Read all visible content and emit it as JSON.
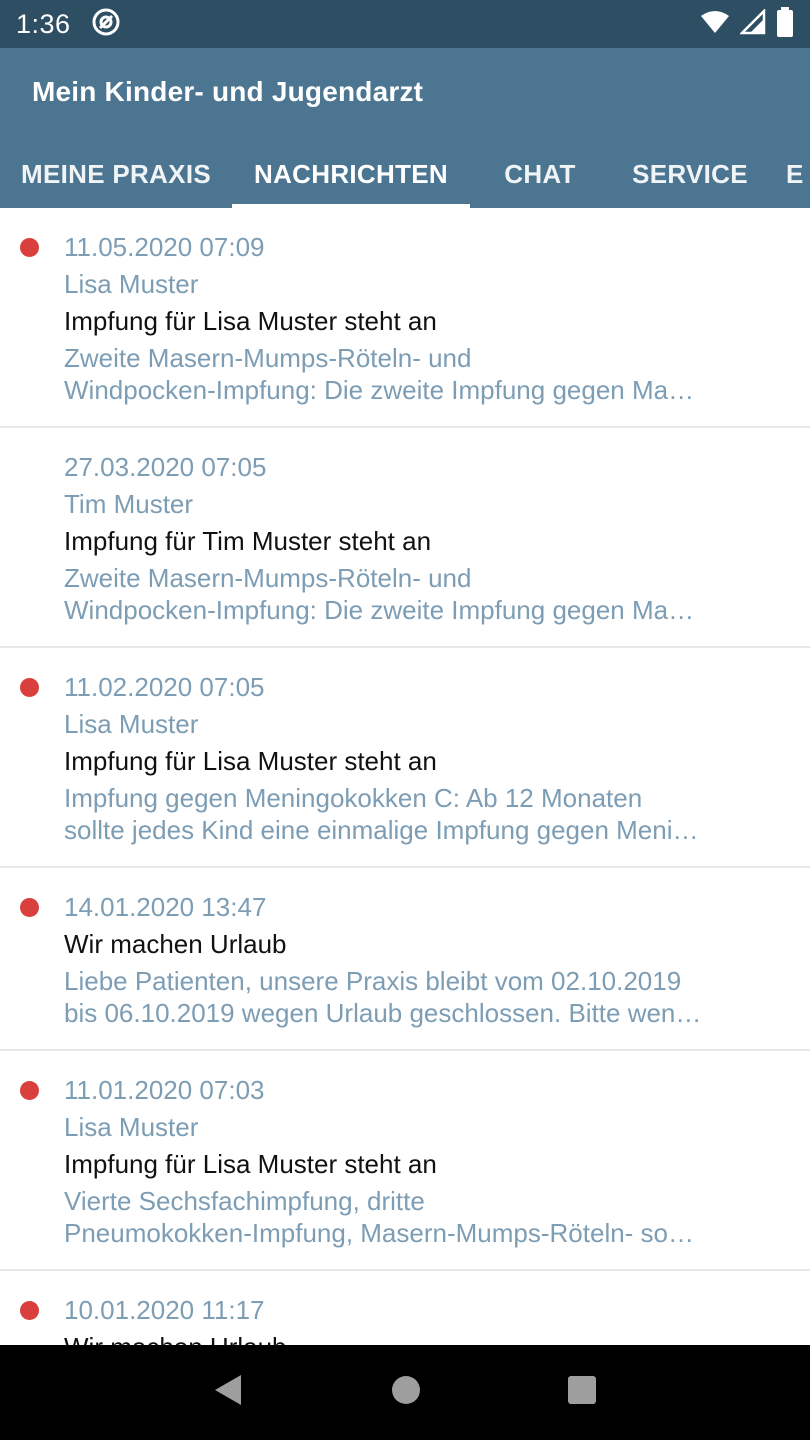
{
  "status_bar": {
    "time": "1:36",
    "icons": [
      "at-sign-icon",
      "wifi-icon",
      "signal-icon",
      "battery-icon"
    ]
  },
  "app": {
    "title": "Mein Kinder- und Jugendarzt"
  },
  "tabs": [
    {
      "label": "MEINE PRAXIS"
    },
    {
      "label": "NACHRICHTEN",
      "active": true
    },
    {
      "label": "CHAT"
    },
    {
      "label": "SERVICE"
    },
    {
      "label": "E"
    }
  ],
  "messages": [
    {
      "unread": true,
      "date": "11.05.2020 07:09",
      "recipient": "Lisa Muster",
      "subject": "Impfung für Lisa Muster steht an",
      "preview_line1": "Zweite Masern-Mumps-Röteln- und",
      "preview_line2": "Windpocken-Impfung: Die zweite Impfung gegen Ma…"
    },
    {
      "unread": false,
      "date": "27.03.2020 07:05",
      "recipient": "Tim Muster",
      "subject": "Impfung für Tim Muster steht an",
      "preview_line1": "Zweite Masern-Mumps-Röteln- und",
      "preview_line2": "Windpocken-Impfung: Die zweite Impfung gegen Ma…"
    },
    {
      "unread": true,
      "date": "11.02.2020 07:05",
      "recipient": "Lisa Muster",
      "subject": "Impfung für Lisa Muster steht an",
      "preview_line1": "Impfung gegen Meningokokken C: Ab 12 Monaten",
      "preview_line2": "sollte jedes Kind eine einmalige Impfung gegen Meni…"
    },
    {
      "unread": true,
      "date": "14.01.2020 13:47",
      "subject": "Wir machen Urlaub",
      "preview_line1": "Liebe Patienten, unsere Praxis bleibt vom 02.10.2019",
      "preview_line2": "bis 06.10.2019 wegen Urlaub geschlossen. Bitte wen…"
    },
    {
      "unread": true,
      "date": "11.01.2020 07:03",
      "recipient": "Lisa Muster",
      "subject": "Impfung für Lisa Muster steht an",
      "preview_line1": "Vierte Sechsfachimpfung, dritte",
      "preview_line2": "Pneumokokken-Impfung, Masern-Mumps-Röteln- so…"
    },
    {
      "unread": true,
      "date": "10.01.2020 11:17",
      "subject": "Wir machen Urlaub"
    }
  ],
  "nav_bar": {
    "icons": [
      "back-icon",
      "home-icon",
      "recents-icon"
    ]
  }
}
